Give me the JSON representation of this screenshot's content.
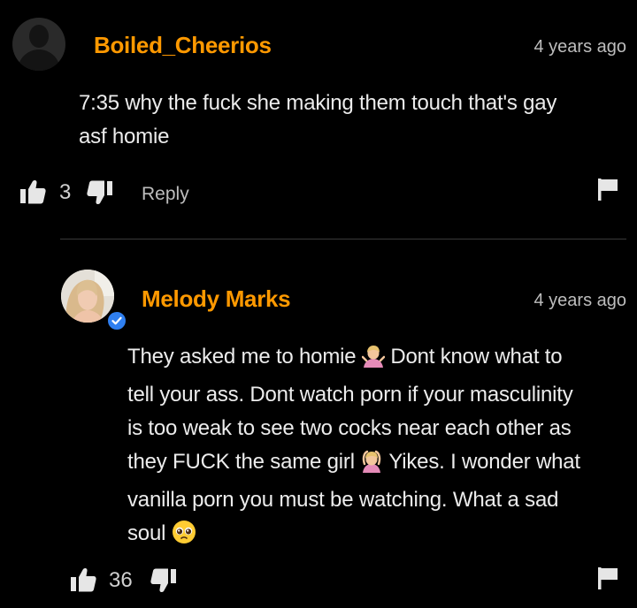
{
  "comments": [
    {
      "username": "Boiled_Cheerios",
      "timestamp": "4 years ago",
      "text_line1": "7:35 why the fuck she making them touch that's gay",
      "text_line2": "asf homie",
      "likes": "3",
      "reply_label": "Reply"
    },
    {
      "username": "Melody Marks",
      "timestamp": "4 years ago",
      "verified": true,
      "line1_a": "They asked me to homie ",
      "line1_b": " Dont know what to",
      "line2": "tell your ass. Dont watch porn if your masculinity",
      "line3": "is too weak to see two cocks near each other as",
      "line4_a": "they FUCK the same girl ",
      "line4_b": " Yikes. I wonder what",
      "line5": "vanilla porn you must be watching. What a sad",
      "line6": "soul ",
      "likes": "36"
    }
  ],
  "colors": {
    "background": "#000000",
    "username": "#ff9900",
    "text": "#ececec",
    "muted": "#bdbdbd",
    "verified_badge": "#2f7ff0"
  },
  "icons": [
    "thumbs-up-icon",
    "thumbs-down-icon",
    "flag-icon",
    "verified-badge-icon",
    "person-shrugging-emoji",
    "person-gesturing-ok-emoji",
    "pleading-face-emoji"
  ]
}
